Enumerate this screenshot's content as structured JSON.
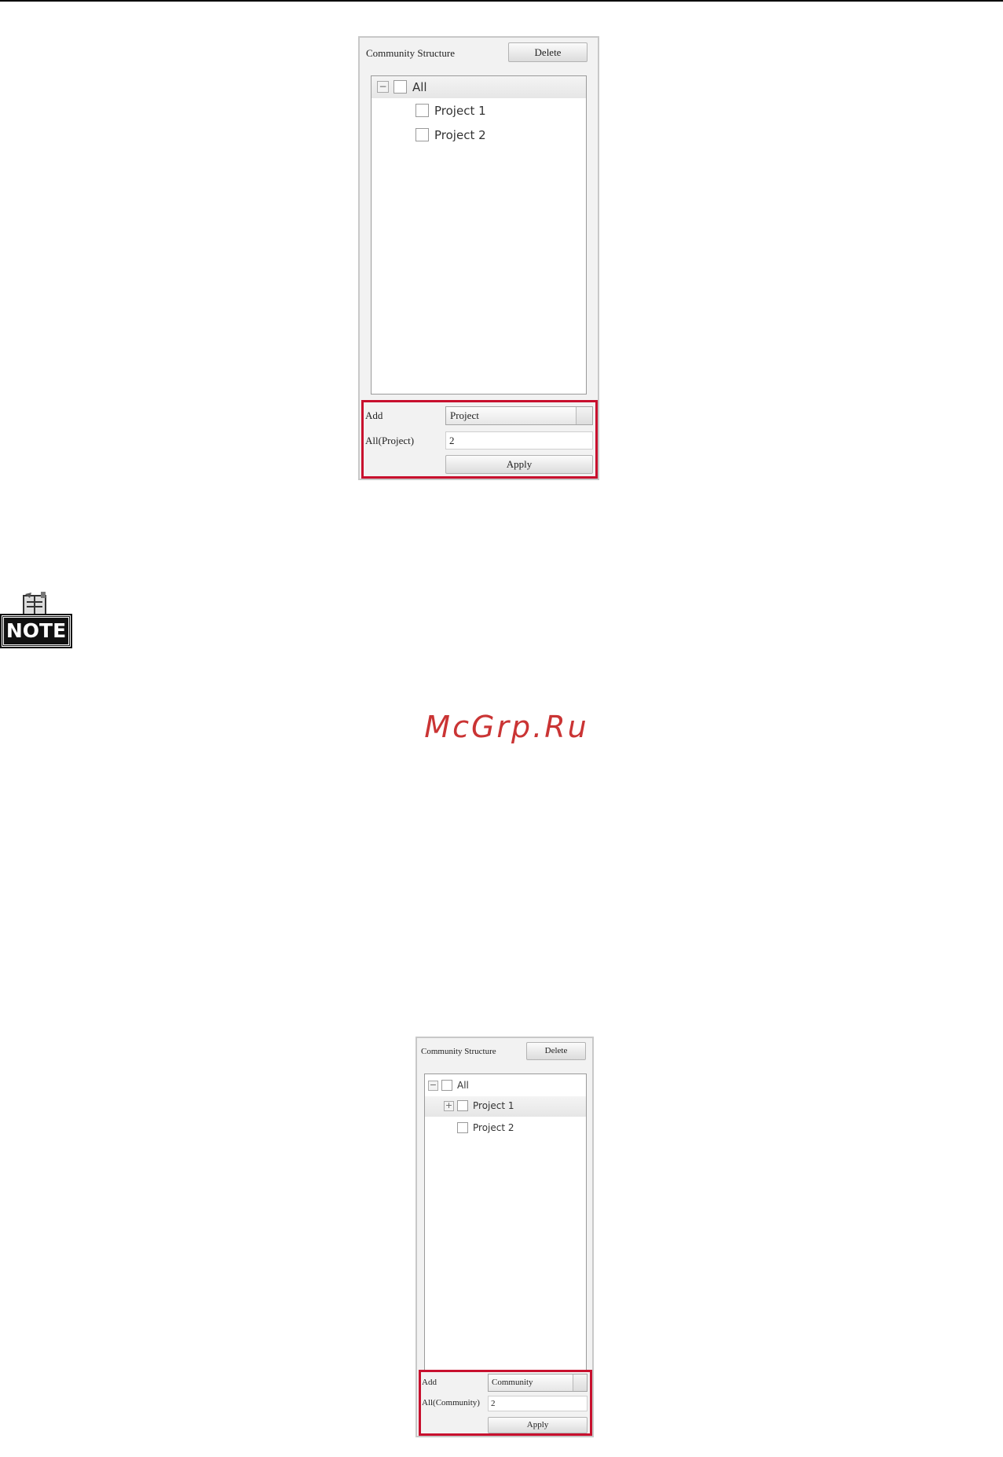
{
  "panel_top": {
    "title": "Community Structure",
    "delete_label": "Delete",
    "tree": {
      "root_label": "All",
      "root_toggle": "−",
      "children": [
        "Project 1",
        "Project 2"
      ]
    },
    "form": {
      "add_label": "Add",
      "add_selected": "Project",
      "count_label": "All(Project)",
      "count_value": "2",
      "apply_label": "Apply"
    }
  },
  "note_icon": {
    "label": "NOTE",
    "icon": "note-icon"
  },
  "watermark": "McGrp.Ru",
  "panel_bottom": {
    "title": "Community Structure",
    "delete_label": "Delete",
    "tree": {
      "root_label": "All",
      "root_toggle": "−",
      "child_toggle": "+",
      "children": [
        "Project 1",
        "Project 2"
      ]
    },
    "form": {
      "add_label": "Add",
      "add_selected": "Community",
      "count_label": "All(Community)",
      "count_value": "2",
      "apply_label": "Apply"
    }
  },
  "colors": {
    "highlight_frame": "#c8102e",
    "watermark": "#c82a2a"
  }
}
